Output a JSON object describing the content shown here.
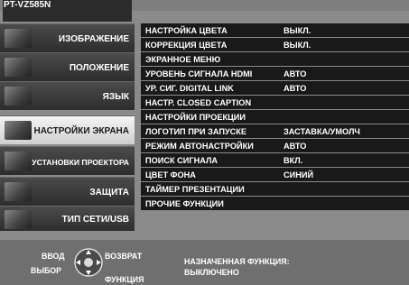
{
  "window": {
    "model": "PT-VZ585N"
  },
  "sidebar": {
    "items": [
      {
        "label": "ИЗОБРАЖЕНИЕ",
        "icon": "picture-icon",
        "active": false
      },
      {
        "label": "ПОЛОЖЕНИЕ",
        "icon": "position-icon",
        "active": false
      },
      {
        "label": "ЯЗЫК",
        "icon": "language-icon",
        "active": false
      },
      {
        "label": "НАСТРОЙКИ ЭКРАНА",
        "icon": "display-settings-icon",
        "active": true
      },
      {
        "label": "УСТАНОВКИ ПРОЕКТОРА",
        "icon": "projector-setup-icon",
        "active": false
      },
      {
        "label": "ЗАЩИТА",
        "icon": "lock-icon",
        "active": false
      },
      {
        "label": "ТИП СЕТИ/USB",
        "icon": "network-icon",
        "active": false
      }
    ]
  },
  "menu": {
    "rows": [
      {
        "label": "НАСТРОЙКА ЦВЕТА",
        "value": "ВЫКЛ."
      },
      {
        "label": "КОРРЕКЦИЯ ЦВЕТА",
        "value": "ВЫКЛ."
      },
      {
        "label": "ЭКРАННОЕ МЕНЮ",
        "value": ""
      },
      {
        "label": "УРОВЕНЬ СИГНАЛА HDMI",
        "value": "АВТО"
      },
      {
        "label": "УР. СИГ. DIGITAL LINK",
        "value": "АВТО"
      },
      {
        "label": "НАСТР. CLOSED CAPTION",
        "value": ""
      },
      {
        "label": "НАСТРОЙКИ ПРОЕКЦИИ",
        "value": ""
      },
      {
        "label": "ЛОГОТИП ПРИ ЗАПУСКЕ",
        "value": "ЗАСТАВКА/УМОЛЧ"
      },
      {
        "label": "РЕЖИМ АВТОНАСТРОЙКИ",
        "value": "АВТО"
      },
      {
        "label": "ПОИСК СИГНАЛА",
        "value": "ВКЛ."
      },
      {
        "label": "ЦВЕТ ФОНА",
        "value": "СИНИЙ"
      },
      {
        "label": "ТАЙМЕР ПРЕЗЕНТАЦИИ",
        "value": ""
      },
      {
        "label": "ПРОЧИЕ ФУНКЦИИ",
        "value": ""
      }
    ]
  },
  "footer": {
    "enter": "ВВОД",
    "select": "ВЫБОР",
    "back": "ВОЗВРАТ",
    "function": "ФУНКЦИЯ",
    "assigned_label": "НАЗНАЧЕННАЯ ФУНКЦИЯ:",
    "assigned_value": "ВЫКЛЮЧЕНО"
  },
  "colors": {
    "row_bg": "#191919",
    "panel_bg": "#8a8a8a",
    "active_item": "#e8e8e8",
    "header_bg": "#2b2b2b"
  }
}
